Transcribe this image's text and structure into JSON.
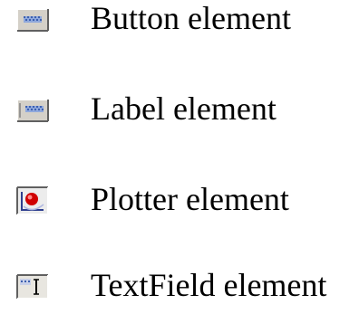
{
  "legend": {
    "items": [
      {
        "icon": "button-element-icon",
        "label": "Button element"
      },
      {
        "icon": "label-element-icon",
        "label": "Label element"
      },
      {
        "icon": "plotter-element-icon",
        "label": "Plotter element"
      },
      {
        "icon": "textfield-element-icon",
        "label": "TextField element"
      }
    ]
  },
  "colors": {
    "icon_face": "#d4d0c8",
    "icon_shadow": "#808080",
    "icon_highlight": "#ffffff",
    "dots": "#3b5fb0",
    "plotter_bezel": "#c0c0c0",
    "plotter_point": "#d00000",
    "text": "#000000"
  }
}
